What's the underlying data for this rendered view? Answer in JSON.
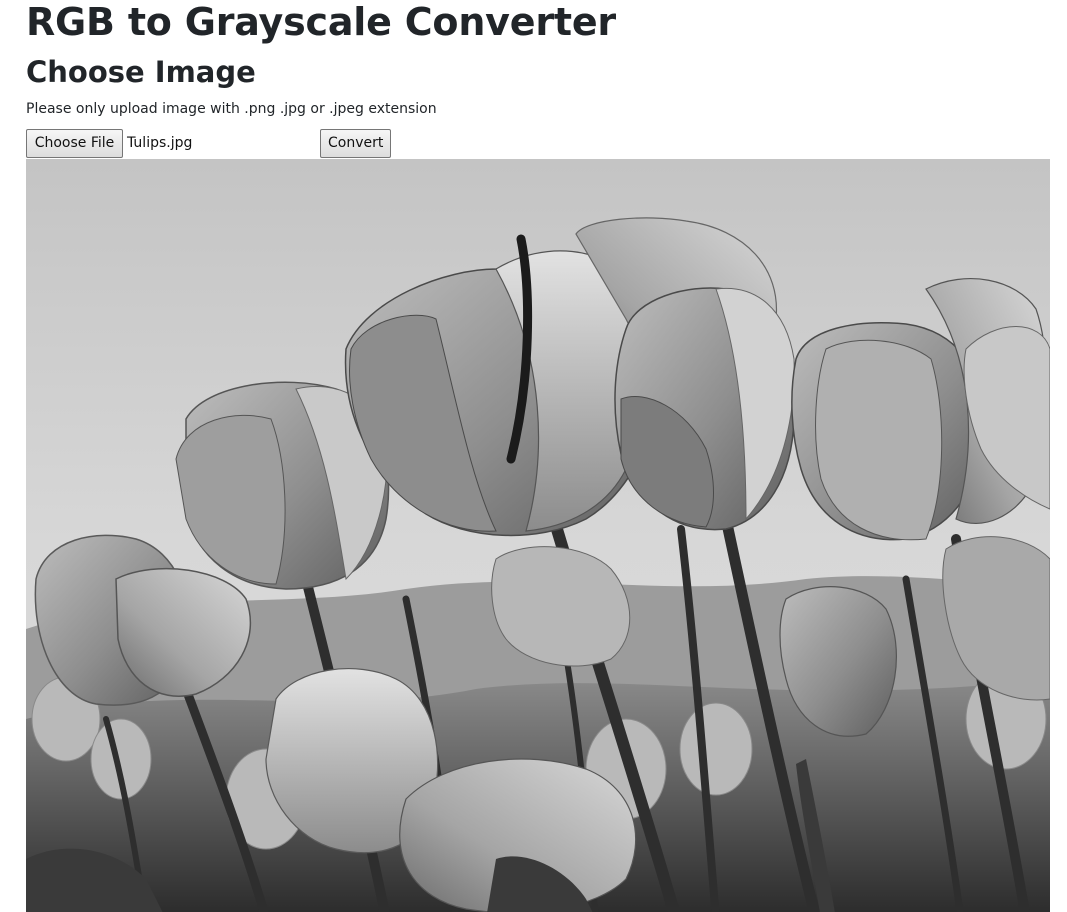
{
  "page": {
    "title": "RGB to Grayscale Converter",
    "section_heading": "Choose Image",
    "hint": "Please only upload image with .png .jpg or .jpeg extension"
  },
  "form": {
    "choose_file_label": "Choose File",
    "file_name": "Tulips.jpg",
    "convert_label": "Convert"
  },
  "preview": {
    "alt": "Tulips.jpg",
    "tone": "grayscale"
  }
}
